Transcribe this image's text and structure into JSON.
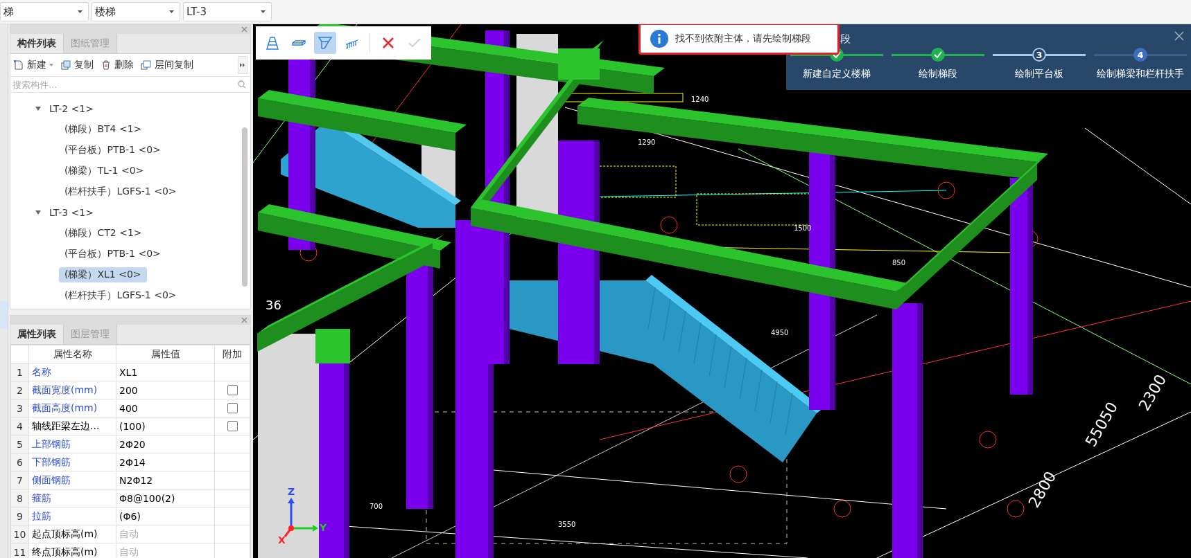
{
  "top_bar": {
    "dropdowns": [
      {
        "value": "梯"
      },
      {
        "value": "楼梯"
      },
      {
        "value": "LT-3"
      }
    ]
  },
  "component_panel": {
    "tabs": [
      {
        "label": "构件列表",
        "selected": true
      },
      {
        "label": "图纸管理",
        "selected": false
      }
    ],
    "toolbar": [
      {
        "kind": "new",
        "label": "新建",
        "has_menu": true
      },
      {
        "kind": "copy",
        "label": "复制",
        "has_menu": false
      },
      {
        "kind": "delete",
        "label": "删除",
        "has_menu": false
      },
      {
        "kind": "floor-copy",
        "label": "层间复制",
        "has_menu": false
      }
    ],
    "search": {
      "placeholder": "搜索构件..."
    },
    "tree": [
      {
        "label": "LT-2 <1>",
        "expanded": true,
        "selected": false,
        "children": [
          {
            "label": "(梯段）BT4 <1>",
            "selected": false
          },
          {
            "label": "(平台板）PTB-1 <0>",
            "selected": false
          },
          {
            "label": "(梯梁）TL-1 <0>",
            "selected": false
          },
          {
            "label": "(栏杆扶手）LGFS-1 <0>",
            "selected": false
          }
        ]
      },
      {
        "label": "LT-3 <1>",
        "expanded": true,
        "selected": false,
        "children": [
          {
            "label": "(梯段）CT2 <1>",
            "selected": false
          },
          {
            "label": "(平台板）PTB-1 <0>",
            "selected": false
          },
          {
            "label": "(梯梁）XL1 <0>",
            "selected": true
          },
          {
            "label": "(栏杆扶手）LGFS-1 <0>",
            "selected": false
          }
        ]
      }
    ]
  },
  "property_panel": {
    "tabs": [
      {
        "label": "属性列表",
        "selected": true
      },
      {
        "label": "图层管理",
        "selected": false
      }
    ],
    "columns": [
      "属性名称",
      "属性值",
      "附加"
    ],
    "rows": [
      {
        "index": "1",
        "name": "名称",
        "value": "XL1",
        "public": true,
        "greyed": false,
        "kind": "plain"
      },
      {
        "index": "2",
        "name": "截面宽度(mm)",
        "value": "200",
        "public": true,
        "greyed": false,
        "kind": "checkbox",
        "checked": false
      },
      {
        "index": "3",
        "name": "截面高度(mm)",
        "value": "400",
        "public": true,
        "greyed": false,
        "kind": "checkbox",
        "checked": false
      },
      {
        "index": "4",
        "name": "轴线距梁左边...",
        "value": "(100)",
        "public": false,
        "greyed": false,
        "kind": "checkbox",
        "checked": false
      },
      {
        "index": "5",
        "name": "上部钢筋",
        "value": "2Φ20",
        "public": true,
        "greyed": false,
        "kind": "plain"
      },
      {
        "index": "6",
        "name": "下部钢筋",
        "value": "2Φ14",
        "public": true,
        "greyed": false,
        "kind": "plain"
      },
      {
        "index": "7",
        "name": "侧面钢筋",
        "value": "N2Φ12",
        "public": true,
        "greyed": false,
        "kind": "plain"
      },
      {
        "index": "8",
        "name": "箍筋",
        "value": "Φ8@100(2)",
        "public": true,
        "greyed": false,
        "kind": "plain"
      },
      {
        "index": "9",
        "name": "拉筋",
        "value": "(Φ6)",
        "public": true,
        "greyed": false,
        "kind": "plain"
      },
      {
        "index": "10",
        "name": "起点顶标高(m)",
        "value": "自动",
        "public": false,
        "greyed": true,
        "kind": "plain"
      },
      {
        "index": "11",
        "name": "终点顶标高(m)",
        "value": "自动",
        "public": false,
        "greyed": true,
        "kind": "plain"
      }
    ]
  },
  "viewport": {
    "tools": [
      {
        "kind": "stair",
        "selected": false
      },
      {
        "kind": "slab",
        "selected": false
      },
      {
        "kind": "beam",
        "selected": true
      },
      {
        "kind": "railing",
        "selected": false
      }
    ],
    "actions": [
      {
        "kind": "cancel",
        "disabled": false
      },
      {
        "kind": "confirm",
        "disabled": true
      }
    ],
    "toast": {
      "message": "找不到依附主体，请先绘制梯段"
    },
    "wizard": {
      "title": "段",
      "steps": [
        {
          "label": "新建自定义楼梯",
          "kind": "done"
        },
        {
          "label": "绘制梯段",
          "kind": "done"
        },
        {
          "number": "3",
          "label": "绘制平台板",
          "kind": "current"
        },
        {
          "number": "4",
          "label": "绘制梯梁和栏杆扶手",
          "kind": "todo"
        }
      ]
    },
    "cad_labels": [
      "1240",
      "1290",
      "1500",
      "850",
      "4950",
      "3550",
      "2300",
      "55050",
      "2800",
      "700",
      "36"
    ],
    "axis_labels": [
      "Z",
      "X",
      "Y"
    ]
  }
}
